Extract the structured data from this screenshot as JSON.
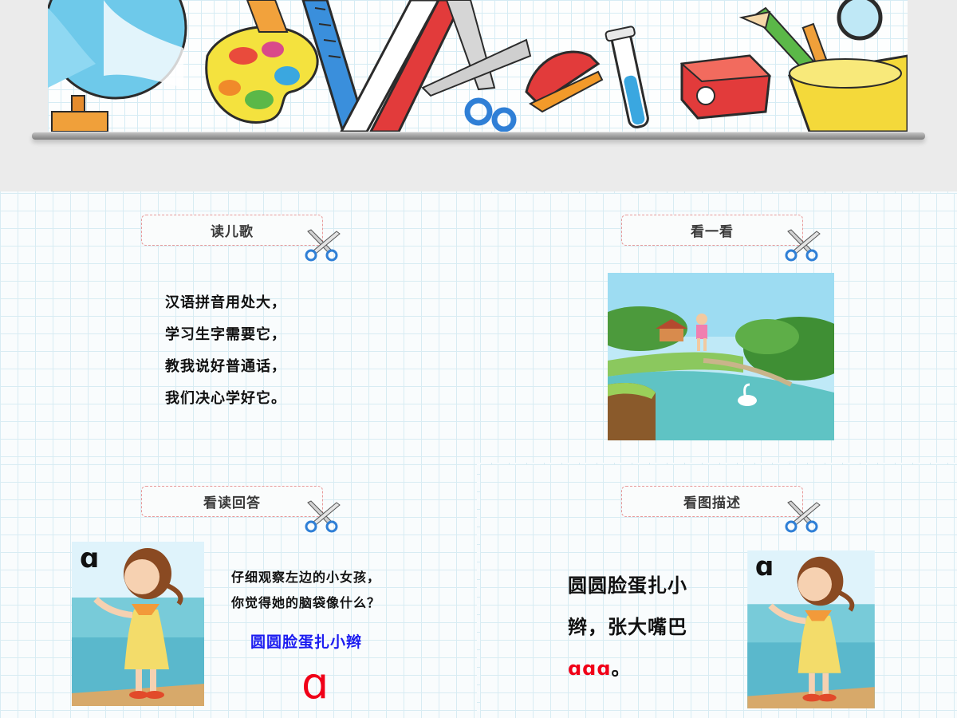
{
  "panels": {
    "read_song": {
      "label": "读儿歌",
      "poem": [
        "汉语拼音用处大，",
        "学习生字需要它，",
        "教我说好普通话，",
        "我们决心学好它。"
      ]
    },
    "look": {
      "label": "看一看"
    },
    "look_answer": {
      "label": "看读回答",
      "girl_letter": "ɑ",
      "question": [
        "仔细观察左边的小女孩，",
        "你觉得她的脑袋像什么？"
      ],
      "answer": "圆圆脸蛋扎小辫",
      "letter": "ɑ"
    },
    "describe": {
      "label": "看图描述",
      "line1": "圆圆脸蛋扎小",
      "line2": "辫，张大嘴巴",
      "letters": "ɑɑɑ",
      "period": "。",
      "girl_letter": "ɑ"
    }
  },
  "colors": {
    "label_border": "#e89a9a",
    "blue_text": "#1b1bf0",
    "red_letter": "#f00018",
    "grid_line": "#d8ecf3"
  },
  "icons": [
    "scissors-icon",
    "globe-illustration",
    "paint-palette-illustration",
    "ruler-illustration",
    "stapler-illustration",
    "test-tube-illustration",
    "pencil-sharpener-illustration",
    "pencil-cup-illustration"
  ]
}
